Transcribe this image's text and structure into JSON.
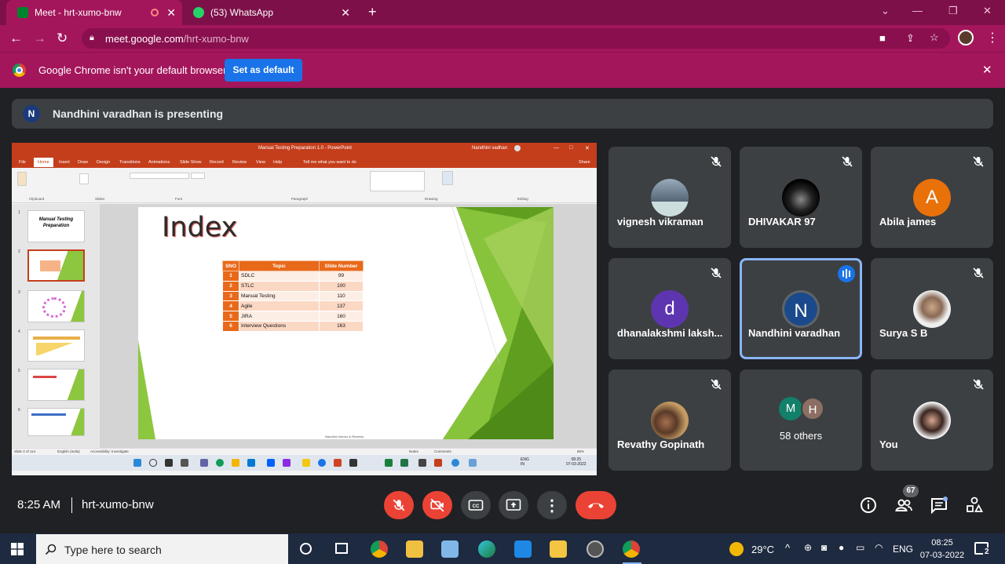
{
  "browser": {
    "tabs": [
      {
        "title": "Meet - hrt-xumo-bnw",
        "active": true
      },
      {
        "title": "(53) WhatsApp",
        "active": false
      }
    ],
    "url_host": "meet.google.com",
    "url_path": "/hrt-xumo-bnw",
    "infobar_message": "Google Chrome isn't your default browser",
    "set_default_label": "Set as default"
  },
  "meet": {
    "presenter_initial": "N",
    "presenting_text": "Nandhini varadhan is presenting",
    "time": "8:25 AM",
    "meeting_code": "hrt-xumo-bnw",
    "participant_count": "67",
    "participants": [
      {
        "name": "vignesh vikraman",
        "muted": true
      },
      {
        "name": "DHIVAKAR 97",
        "muted": true
      },
      {
        "name": "Abila james",
        "initial": "A",
        "color": "#e8710a",
        "muted": true
      },
      {
        "name": "dhanalakshmi laksh...",
        "initial": "d",
        "color": "#5e35b1",
        "muted": true
      },
      {
        "name": "Nandhini varadhan",
        "initial": "N",
        "color": "#1a4a8c",
        "speaking": true
      },
      {
        "name": "Surya S B",
        "muted": true
      },
      {
        "name": "Revathy Gopinath",
        "muted": true
      },
      {
        "others_label": "58 others",
        "initials": [
          "M",
          "H"
        ]
      },
      {
        "name": "You",
        "muted": true
      }
    ]
  },
  "ppt": {
    "window_title": "Manual Testing Preparation 1.0  -  PowerPoint",
    "user": "Nandhini vadhan",
    "menu": [
      "File",
      "Home",
      "Insert",
      "Draw",
      "Design",
      "Transitions",
      "Animations",
      "Slide Show",
      "Record",
      "Review",
      "View",
      "Help",
      "Tell me what you want to do"
    ],
    "share": "Share",
    "ribbon_groups": [
      "Clipboard",
      "Slides",
      "Font",
      "Paragraph",
      "Drawing",
      "Editing"
    ],
    "thumb_numbers": [
      "1",
      "2",
      "3",
      "4",
      "5",
      "6"
    ],
    "thumb1_title": "Manual Testing Preparation",
    "slide_title": "Index",
    "table_headers": [
      "SNO",
      "Topic",
      "Slide Number"
    ],
    "table_rows": [
      [
        "1",
        "SDLC",
        "99"
      ],
      [
        "2",
        "STLC",
        "100"
      ],
      [
        "3",
        "Manual Testing",
        "110"
      ],
      [
        "4",
        "Agile",
        "137"
      ],
      [
        "5",
        "JIRA",
        "160"
      ],
      [
        "6",
        "Interview Questions",
        "163"
      ]
    ],
    "slide_footer": "Nandhini  Interns & Reviews",
    "status_slide": "Slide 2 of 114",
    "status_lang": "English (India)",
    "status_access": "Accessibility: Investigate",
    "status_notes": "Notes",
    "status_comments": "Comments",
    "status_zoom": "85%",
    "remote_lang": "ENG",
    "remote_region": "IN",
    "remote_time": "08:25",
    "remote_date": "07-03-2022"
  },
  "windows": {
    "search_placeholder": "Type here to search",
    "weather": "29°C",
    "lang": "ENG",
    "time": "08:25",
    "date": "07-03-2022",
    "notifications": "2"
  },
  "colors": {
    "chrome_theme": "#a4165c",
    "meet_bg": "#202124",
    "tile_bg": "#3c4043",
    "end_call": "#ea4335",
    "accent_blue": "#1a73e8",
    "ppt_orange": "#c43e1c"
  }
}
